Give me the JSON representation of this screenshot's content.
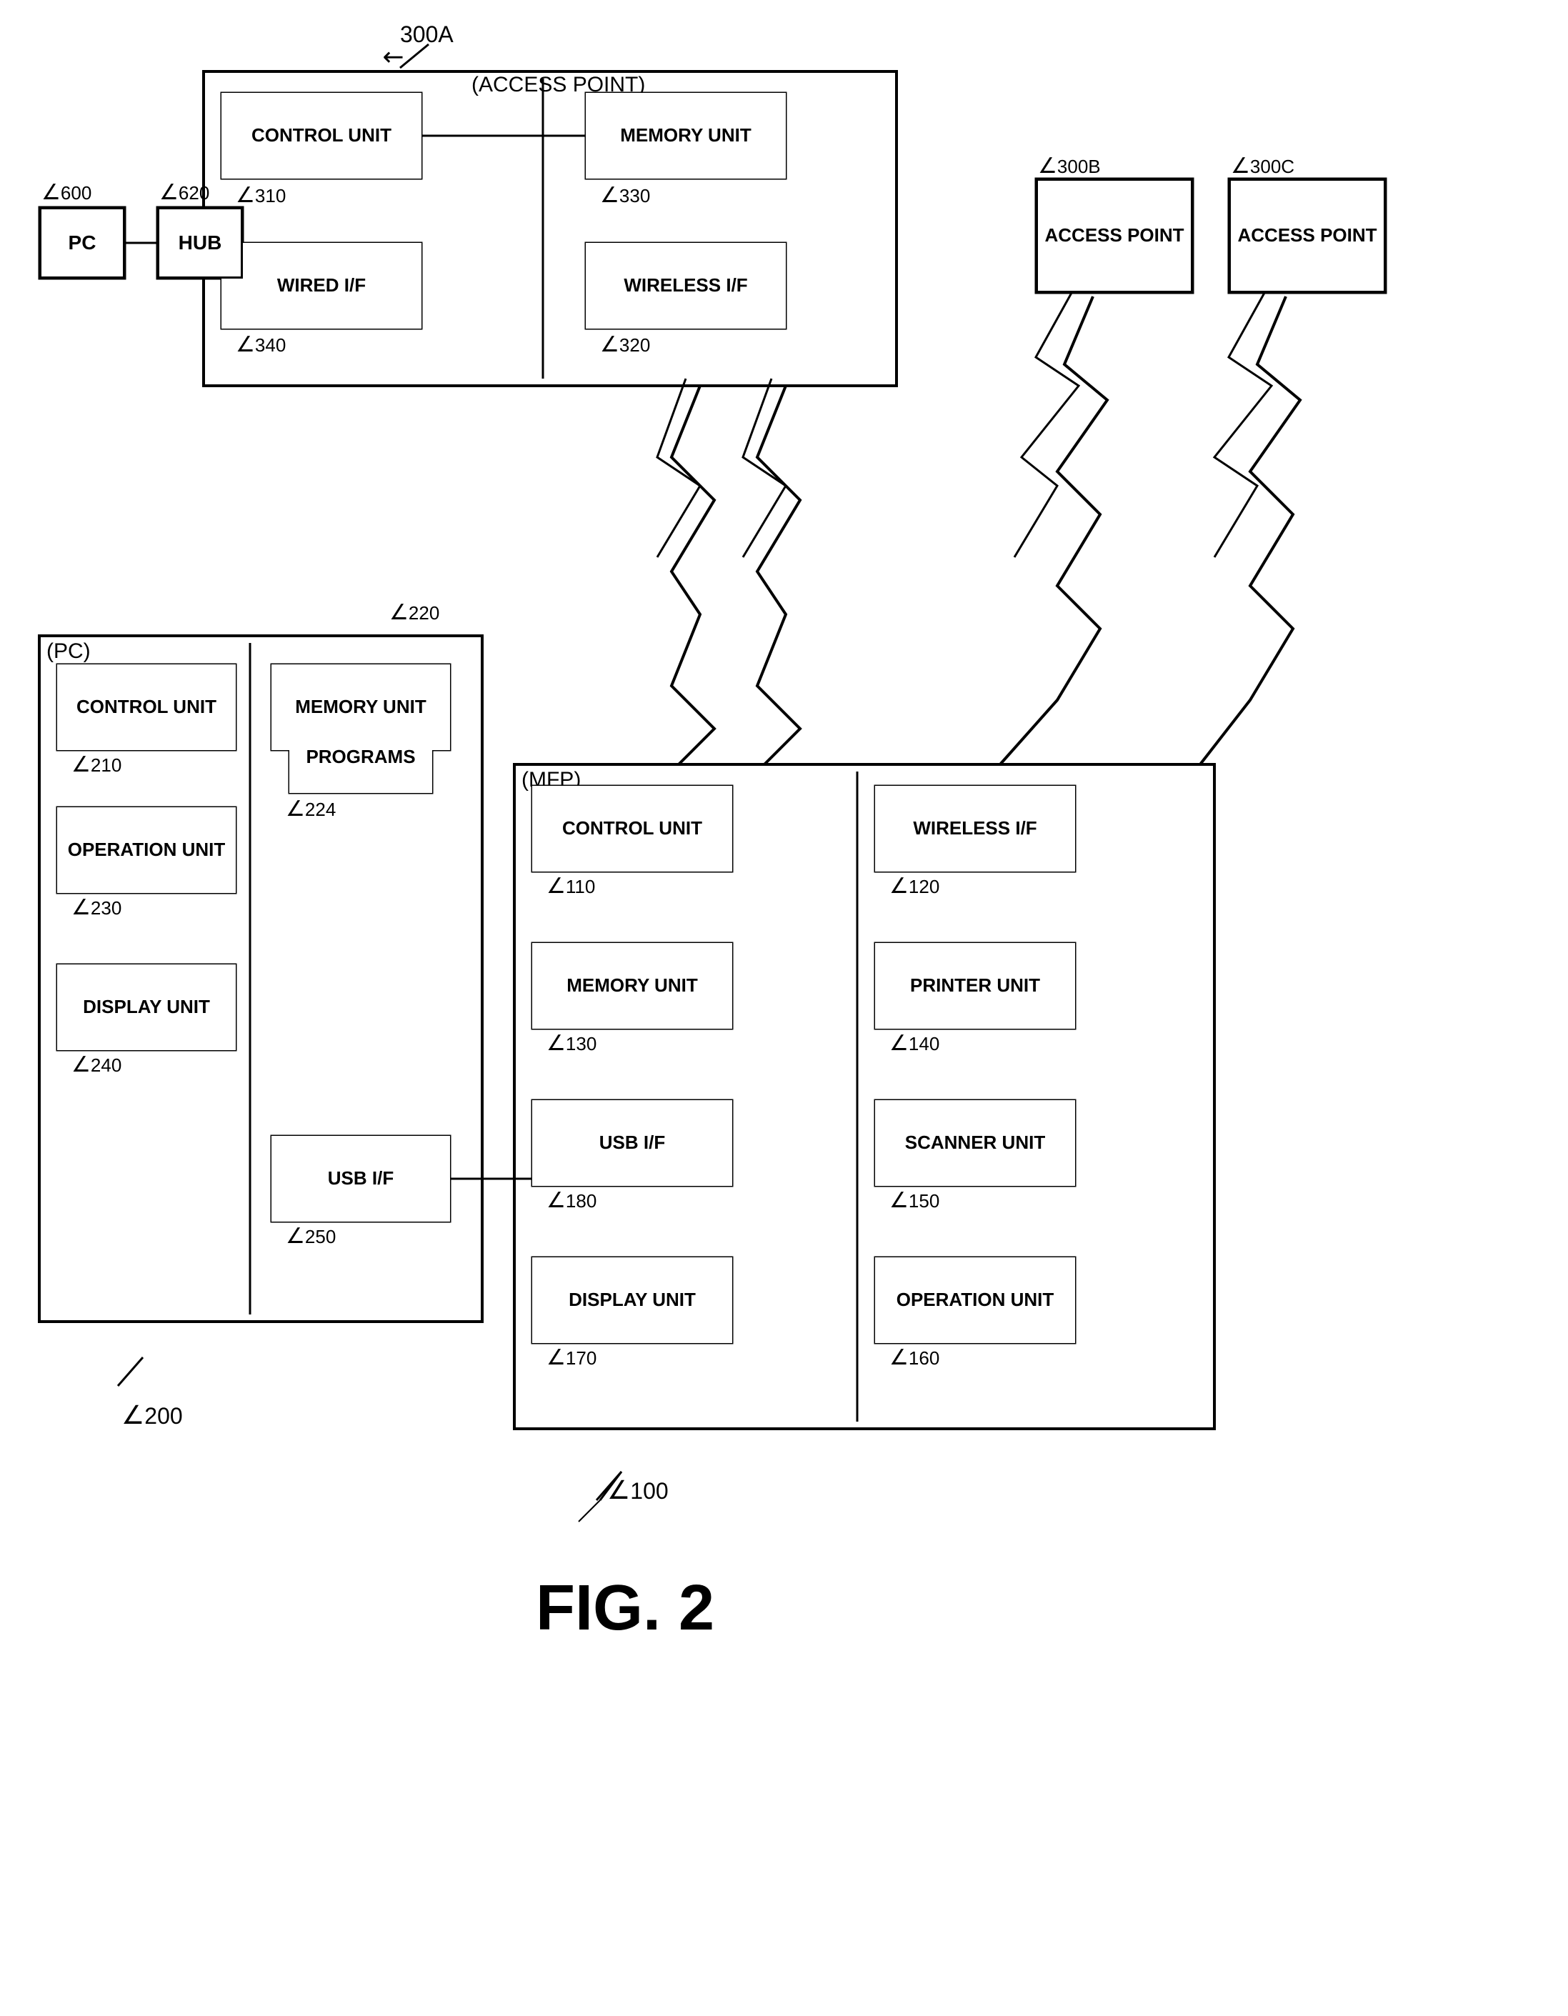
{
  "title": "FIG. 2",
  "diagram": {
    "access_point_label": "(ACCESS POINT)",
    "ap_ref": "300A",
    "ap_ref_arrow": "↙",
    "mfp_label": "(MFP)",
    "pc_label": "(PC)",
    "fig_label": "FIG. 2",
    "boxes": {
      "ap_control_unit": {
        "label": "CONTROL UNIT",
        "ref": "310"
      },
      "ap_memory_unit": {
        "label": "MEMORY UNIT",
        "ref": "330"
      },
      "ap_wired_if": {
        "label": "WIRED I/F",
        "ref": "340"
      },
      "ap_wireless_if": {
        "label": "WIRELESS I/F",
        "ref": "320"
      },
      "ap_outer": {
        "label": ""
      },
      "pc_box": {
        "label": "PC",
        "ref": "600"
      },
      "hub_box": {
        "label": "HUB",
        "ref": "620"
      },
      "access_point_b": {
        "label": "ACCESS POINT",
        "ref": "300B"
      },
      "access_point_c": {
        "label": "ACCESS POINT",
        "ref": "300C"
      },
      "pc_control_unit": {
        "label": "CONTROL UNIT",
        "ref": "210"
      },
      "pc_memory_unit": {
        "label": "MEMORY UNIT",
        "ref": "220"
      },
      "pc_programs": {
        "label": "PROGRAMS",
        "ref": "224"
      },
      "pc_operation_unit": {
        "label": "OPERATION UNIT",
        "ref": "230"
      },
      "pc_display_unit": {
        "label": "DISPLAY UNIT",
        "ref": "240"
      },
      "pc_usb_if": {
        "label": "USB I/F",
        "ref": "250"
      },
      "pc_outer": {
        "label": ""
      },
      "mfp_control_unit": {
        "label": "CONTROL UNIT",
        "ref": "110"
      },
      "mfp_wireless_if": {
        "label": "WIRELESS I/F",
        "ref": "120"
      },
      "mfp_memory_unit": {
        "label": "MEMORY UNIT",
        "ref": "130"
      },
      "mfp_printer_unit": {
        "label": "PRINTER UNIT",
        "ref": "140"
      },
      "mfp_usb_if": {
        "label": "USB I/F",
        "ref": "180"
      },
      "mfp_scanner_unit": {
        "label": "SCANNER UNIT",
        "ref": "150"
      },
      "mfp_display_unit": {
        "label": "DISPLAY UNIT",
        "ref": "170"
      },
      "mfp_operation_unit": {
        "label": "OPERATION UNIT",
        "ref": "160"
      },
      "mfp_outer": {
        "label": ""
      }
    }
  }
}
